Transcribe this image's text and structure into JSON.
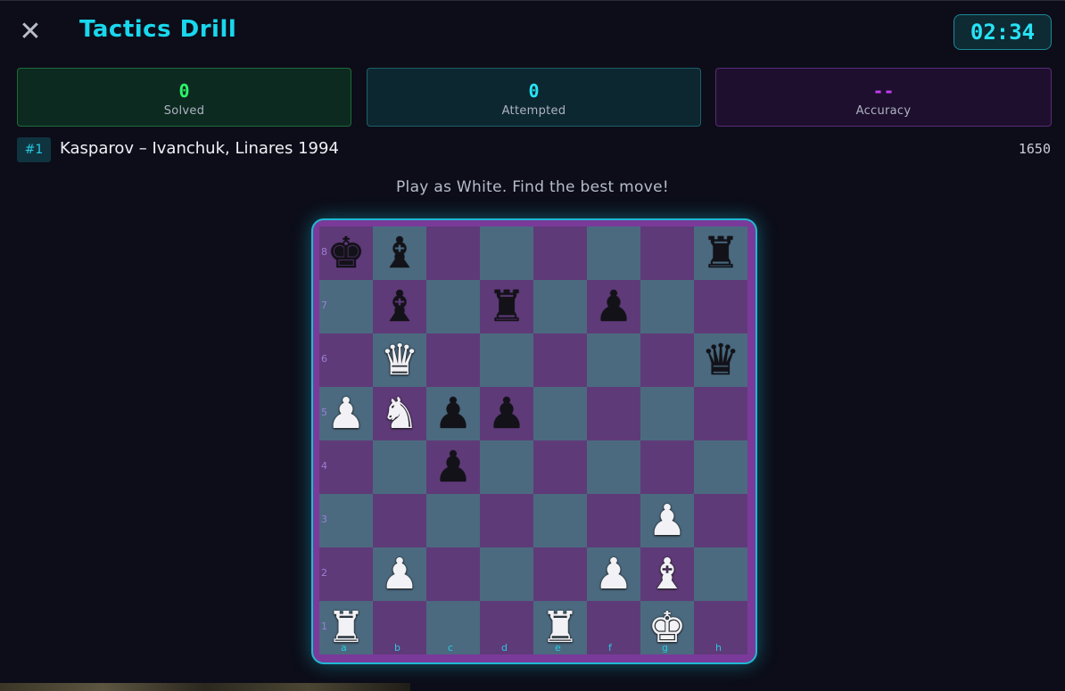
{
  "header": {
    "title": "Tactics Drill",
    "timer": "02:34",
    "close_symbol": "✕"
  },
  "stats": {
    "solved": {
      "value": "0",
      "label": "Solved"
    },
    "attempted": {
      "value": "0",
      "label": "Attempted"
    },
    "accuracy": {
      "value": "--",
      "label": "Accuracy"
    }
  },
  "puzzle": {
    "number": "#1",
    "game": "Kasparov – Ivanchuk, Linares 1994",
    "rating": "1650",
    "prompt": "Play as White. Find the best move!"
  },
  "colors": {
    "accent": "#19d7ee",
    "solved": "#2cf56a",
    "accuracy": "#c03cf0",
    "light_square": "#4b6a80",
    "dark_square": "#5f3a78"
  },
  "board": {
    "files": [
      "a",
      "b",
      "c",
      "d",
      "e",
      "f",
      "g",
      "h"
    ],
    "ranks": [
      "8",
      "7",
      "6",
      "5",
      "4",
      "3",
      "2",
      "1"
    ],
    "rows": [
      [
        "bk",
        "bb",
        "",
        "",
        "",
        "",
        "",
        "br"
      ],
      [
        "",
        "bb",
        "",
        "br",
        "",
        "bp",
        "",
        ""
      ],
      [
        "",
        "wq",
        "",
        "",
        "",
        "",
        "",
        "bq"
      ],
      [
        "wp",
        "wn",
        "bp",
        "bp",
        "",
        "",
        "",
        ""
      ],
      [
        "",
        "",
        "bp",
        "",
        "",
        "",
        "",
        ""
      ],
      [
        "",
        "",
        "",
        "",
        "",
        "",
        "wp",
        ""
      ],
      [
        "",
        "wp",
        "",
        "",
        "",
        "wp",
        "wb",
        ""
      ],
      [
        "wr",
        "",
        "",
        "",
        "wr",
        "",
        "wk",
        ""
      ]
    ]
  }
}
